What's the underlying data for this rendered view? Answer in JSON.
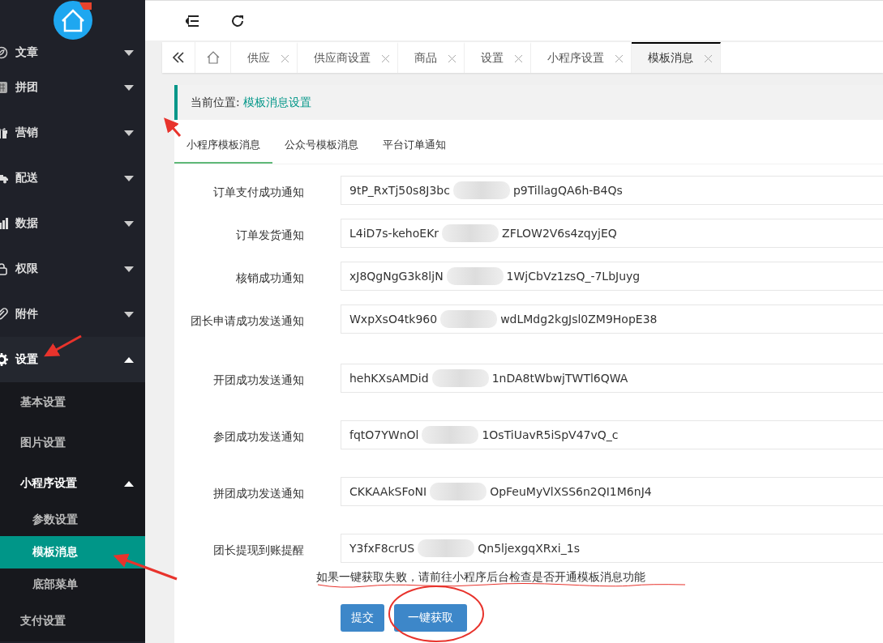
{
  "sidebar": {
    "items": [
      {
        "label": "文章",
        "expanded": false
      },
      {
        "label": "拼团",
        "expanded": false
      },
      {
        "label": "营销",
        "expanded": false
      },
      {
        "label": "配送",
        "expanded": false
      },
      {
        "label": "数据",
        "expanded": false
      },
      {
        "label": "权限",
        "expanded": false
      },
      {
        "label": "附件",
        "expanded": false
      },
      {
        "label": "设置",
        "expanded": true,
        "children": [
          {
            "label": "基本设置",
            "selected": false
          },
          {
            "label": "图片设置",
            "selected": false
          },
          {
            "label": "小程序设置",
            "expanded": true,
            "selected": false,
            "children": [
              {
                "label": "参数设置",
                "selected": false
              },
              {
                "label": "模板消息",
                "selected": true
              },
              {
                "label": "底部菜单",
                "selected": false
              }
            ]
          },
          {
            "label": "支付设置",
            "selected": false
          }
        ]
      }
    ]
  },
  "tabs": [
    {
      "label": "供应",
      "selected": false
    },
    {
      "label": "供应商设置",
      "selected": false
    },
    {
      "label": "商品",
      "selected": false
    },
    {
      "label": "设置",
      "selected": false
    },
    {
      "label": "小程序设置",
      "selected": false
    },
    {
      "label": "模板消息",
      "selected": true
    }
  ],
  "breadcrumb": {
    "label": "当前位置:",
    "current": "模板消息设置"
  },
  "subtabs": [
    {
      "label": "小程序模板消息",
      "selected": true
    },
    {
      "label": "公众号模板消息",
      "selected": false
    },
    {
      "label": "平台订单通知",
      "selected": false
    }
  ],
  "form": {
    "rows": [
      {
        "label": "订单支付成功通知",
        "value_start": "9tP_RxTj50s8J3bc",
        "value_end": "p9TillagQA6h-B4Qs"
      },
      {
        "label": "订单发货通知",
        "value_start": "L4iD7s-kehoEKr",
        "value_end": "ZFLOW2V6s4zqyjEQ"
      },
      {
        "label": "核销成功通知",
        "value_start": "xJ8QgNgG3k8ljN",
        "value_end": "1WjCbVz1zsQ_-7LbJuyg"
      },
      {
        "label": "团长申请成功发送通知",
        "value_start": "WxpXsO4tk960",
        "value_end": "wdLMdg2kgJsl0ZM9HopE38"
      },
      {
        "label": "开团成功发送通知",
        "value_start": "hehKXsAMDid",
        "value_end": "1nDA8tWbwjTWTl6QWA"
      },
      {
        "label": "参团成功发送通知",
        "value_start": "fqtO7YWnOl",
        "value_end": "1OsTiUavR5iSpV47vQ_c"
      },
      {
        "label": "拼团成功发送通知",
        "value_start": "CKKAAkSFoNI",
        "value_end": "OpFeuMyVlXSS6n2QI1M6nJ4"
      },
      {
        "label": "团长提现到账提醒",
        "value_start": "Y3fxF8crUS",
        "value_end": "Qn5ljexgqXRxi_1s"
      }
    ],
    "hint": "如果一键获取失败，请前往小程序后台检查是否开通模板消息功能",
    "buttons": [
      "提交",
      "一键获取"
    ]
  }
}
